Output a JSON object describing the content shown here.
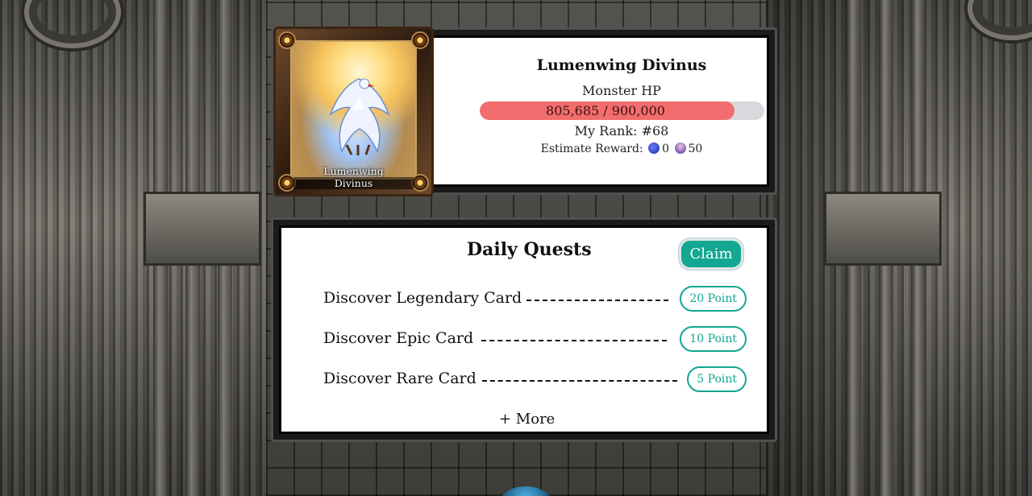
{
  "boss": {
    "card_name_line1": "Lumenwing",
    "card_name_line2": "Divinus",
    "name": "Lumenwing Divinus",
    "hp_label": "Monster HP",
    "hp_text": "805,685 / 900,000",
    "hp_current": 805685,
    "hp_max": 900000,
    "rank_text": "My Rank: #68",
    "reward_label": "Estimate Reward:",
    "reward_items": [
      {
        "icon": "blue-token-icon",
        "value": "0"
      },
      {
        "icon": "crystal-token-icon",
        "value": "50"
      }
    ]
  },
  "quests": {
    "title": "Daily Quests",
    "claim_label": "Claim",
    "items": [
      {
        "label": "Discover Legendary Card",
        "points": "20 Point"
      },
      {
        "label": "Discover Epic Card",
        "points": "10 Point"
      },
      {
        "label": "Discover Rare Card",
        "points": "5 Point"
      }
    ],
    "more_label": "+ More"
  },
  "colors": {
    "accent": "#12a892",
    "hp_fill": "#f26d6d",
    "hp_track": "#d7d9dc"
  }
}
